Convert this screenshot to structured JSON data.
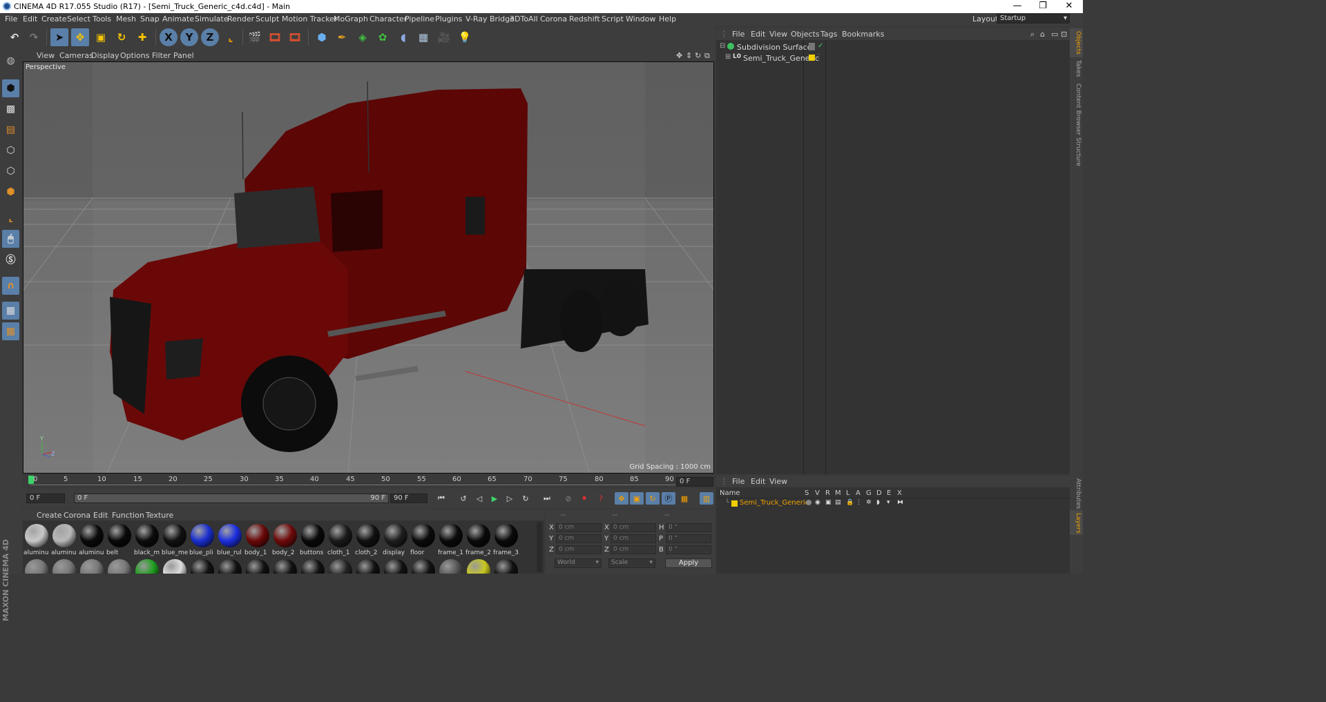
{
  "titlebar": {
    "title": "CINEMA 4D R17.055 Studio (R17) - [Semi_Truck_Generic_c4d.c4d] - Main"
  },
  "menubar": {
    "items": [
      "File",
      "Edit",
      "Create",
      "Select",
      "Tools",
      "Mesh",
      "Snap",
      "Animate",
      "Simulate",
      "Render",
      "Sculpt",
      "Motion Tracker",
      "MoGraph",
      "Character",
      "Pipeline",
      "Plugins",
      "V-Ray Bridge",
      "3DToAll",
      "Corona",
      "Redshift",
      "Script",
      "Window",
      "Help"
    ],
    "layout_label": "Layout:",
    "layout_value": "Startup"
  },
  "toolbar": {
    "x": "X",
    "y": "Y",
    "z": "Z"
  },
  "viewport": {
    "menu": [
      "View",
      "Cameras",
      "Display",
      "Options",
      "Filter",
      "Panel"
    ],
    "camera": "Perspective",
    "grid_spacing": "Grid Spacing : 1000 cm",
    "axis_y": "Y",
    "axis_z": "Z"
  },
  "timeline": {
    "ticks": [
      "0",
      "5",
      "10",
      "15",
      "20",
      "25",
      "30",
      "35",
      "40",
      "45",
      "50",
      "55",
      "60",
      "65",
      "70",
      "75",
      "80",
      "85",
      "90"
    ],
    "current_frame": "0 F",
    "start_frame": "0 F",
    "range_start": "0 F",
    "range_end": "90 F",
    "end_frame": "90 F"
  },
  "materials": {
    "menu": [
      "Create",
      "Corona",
      "Edit",
      "Function",
      "Texture"
    ],
    "row1": [
      {
        "name": "aluminu",
        "color": "#c8c8c8"
      },
      {
        "name": "aluminu",
        "color": "#b8b8b8"
      },
      {
        "name": "aluminu",
        "color": "#0a0a0a"
      },
      {
        "name": "belt",
        "color": "#080808"
      },
      {
        "name": "black_m",
        "color": "#0c0c0c"
      },
      {
        "name": "blue_me",
        "color": "#111111"
      },
      {
        "name": "blue_pli",
        "color": "#1a2fd0"
      },
      {
        "name": "blue_rul",
        "color": "#1d2fe0"
      },
      {
        "name": "body_1",
        "color": "#6a0808"
      },
      {
        "name": "body_2",
        "color": "#6f0a0a"
      },
      {
        "name": "buttons",
        "color": "#090909"
      },
      {
        "name": "cloth_1",
        "color": "#1a1a1a"
      },
      {
        "name": "cloth_2",
        "color": "#101010"
      },
      {
        "name": "display",
        "color": "#1e1e1e"
      },
      {
        "name": "floor",
        "color": "#0b0b0b"
      },
      {
        "name": "frame_1",
        "color": "#0a0a0a"
      },
      {
        "name": "frame_2",
        "color": "#0a0a0a"
      },
      {
        "name": "frame_3",
        "color": "#0a0a0a"
      }
    ],
    "row2_colors": [
      "#777",
      "#777",
      "#777",
      "#777",
      "#1fa01f",
      "#dddddd",
      "#111",
      "#111",
      "#111",
      "#111",
      "#111",
      "#222",
      "#111",
      "#111",
      "#111",
      "#555",
      "#c8c820",
      "#111"
    ]
  },
  "coords": {
    "header": [
      "--",
      "--",
      "--"
    ],
    "x_pos": "0 cm",
    "y_pos": "0 cm",
    "z_pos": "0 cm",
    "x_size": "0 cm",
    "y_size": "0 cm",
    "z_size": "0 cm",
    "h": "0 °",
    "p": "0 °",
    "b": "0 °",
    "pos_label_x": "X",
    "pos_label_y": "Y",
    "pos_label_z": "Z",
    "size_label_x": "X",
    "size_label_y": "Y",
    "size_label_z": "Z",
    "rot_label_h": "H",
    "rot_label_p": "P",
    "rot_label_b": "B",
    "coord_mode": "World",
    "size_mode": "Scale",
    "apply": "Apply"
  },
  "objects": {
    "menu": [
      "File",
      "Edit",
      "View",
      "Objects",
      "Tags",
      "Bookmarks"
    ],
    "items": [
      {
        "name": "Subdivision Surface"
      },
      {
        "name": "Semi_Truck_Generic"
      }
    ]
  },
  "layers": {
    "menu": [
      "File",
      "Edit",
      "View"
    ],
    "header_name": "Name",
    "columns": [
      "S",
      "V",
      "R",
      "M",
      "L",
      "A",
      "G",
      "D",
      "E",
      "X"
    ],
    "row": "Semi_Truck_Generic"
  },
  "right_tabs": [
    "Objects",
    "Takes",
    "Content Browser",
    "Structure",
    "Attributes",
    "Layers"
  ],
  "brand": "MAXON CINEMA 4D"
}
